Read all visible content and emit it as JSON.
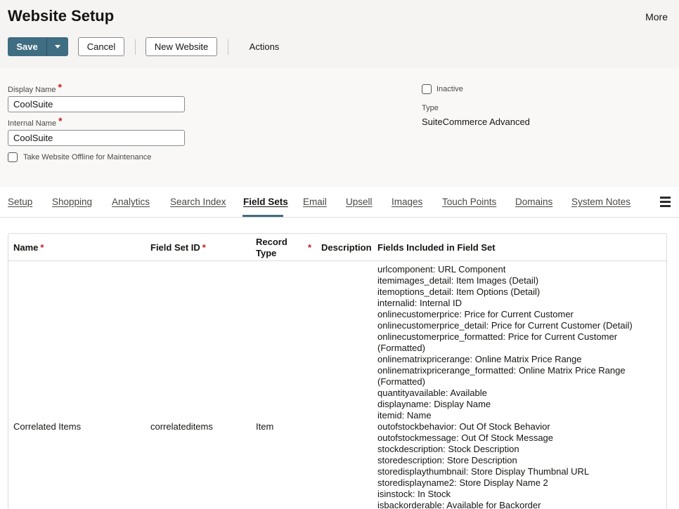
{
  "header": {
    "title": "Website Setup",
    "more": "More"
  },
  "toolbar": {
    "save": "Save",
    "cancel": "Cancel",
    "new_website": "New Website",
    "actions": "Actions"
  },
  "form": {
    "display_name_label": "Display Name",
    "display_name_value": "CoolSuite",
    "internal_name_label": "Internal Name",
    "internal_name_value": "CoolSuite",
    "offline_label": "Take Website Offline for Maintenance",
    "inactive_label": "Inactive",
    "type_label": "Type",
    "type_value": "SuiteCommerce Advanced",
    "required_mark": "*"
  },
  "tabs": [
    {
      "label": "Setup"
    },
    {
      "label": "Shopping"
    },
    {
      "label": "Analytics"
    },
    {
      "label": "Search Index"
    },
    {
      "label": "Field Sets"
    },
    {
      "label": "Email"
    },
    {
      "label": "Upsell"
    },
    {
      "label": "Images"
    },
    {
      "label": "Touch Points"
    },
    {
      "label": "Domains"
    },
    {
      "label": "System Notes"
    }
  ],
  "active_tab": "Field Sets",
  "table": {
    "headers": {
      "name": "Name",
      "field_set_id": "Field Set ID",
      "record_type_line1": "Record",
      "record_type_line2": "Type",
      "description": "Description",
      "fields_included": "Fields Included in Field Set",
      "required_mark": "*"
    },
    "rows": [
      {
        "name": "Correlated Items",
        "field_set_id": "correlateditems",
        "record_type": "Item",
        "fields": [
          "urlcomponent: URL Component",
          "itemimages_detail: Item Images (Detail)",
          "itemoptions_detail: Item Options (Detail)",
          "internalid: Internal ID",
          "onlinecustomerprice: Price for Current Customer",
          "onlinecustomerprice_detail: Price for Current Customer (Detail)",
          "onlinecustomerprice_formatted: Price for Current Customer (Formatted)",
          "onlinematrixpricerange: Online Matrix Price Range",
          "onlinematrixpricerange_formatted: Online Matrix Price Range (Formatted)",
          "quantityavailable: Available",
          "displayname: Display Name",
          "itemid: Name",
          "outofstockbehavior: Out Of Stock Behavior",
          "outofstockmessage: Out Of Stock Message",
          "stockdescription: Stock Description",
          "storedescription: Store Description",
          "storedisplaythumbnail: Store Display Thumbnal URL",
          "storedisplayname2: Store Display Name 2",
          "isinstock: In Stock",
          "isbackorderable: Available for Backorder"
        ]
      }
    ]
  },
  "colors": {
    "primary": "#3f6d82",
    "required": "#c2221b",
    "header_bg": "#f5f4f2"
  }
}
